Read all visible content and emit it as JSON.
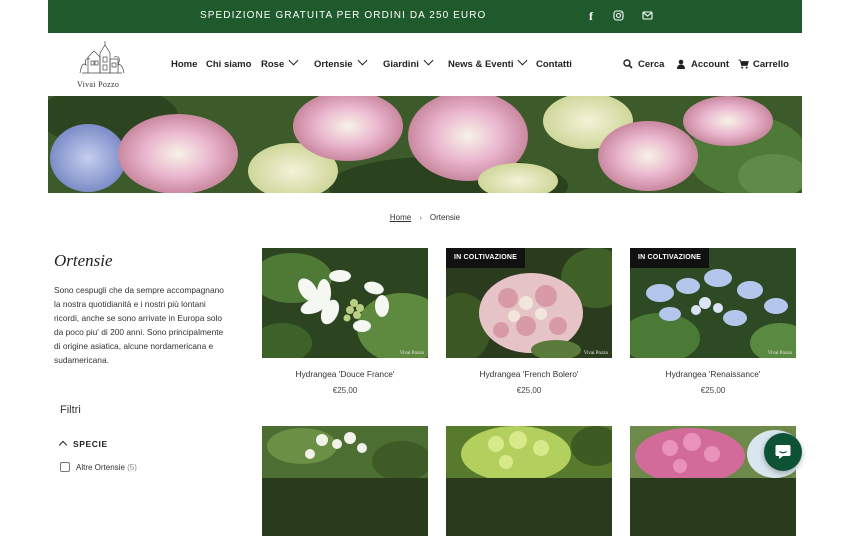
{
  "announcement": {
    "text": "SPEDIZIONE GRATUITA PER ORDINI DA 250 EURO"
  },
  "social": {
    "facebook": "f"
  },
  "logo": {
    "text": "Vivai Pozzo"
  },
  "nav": {
    "items": [
      {
        "label": "Home"
      },
      {
        "label": "Chi siamo"
      },
      {
        "label": "Rose"
      },
      {
        "label": "Ortensie"
      },
      {
        "label": "Giardini"
      },
      {
        "label": "News & Eventi"
      },
      {
        "label": "Contatti"
      }
    ]
  },
  "utility": {
    "search": "Cerca",
    "account": "Account",
    "cart": "Carrello"
  },
  "breadcrumb": {
    "home": "Home",
    "separator": "›",
    "current": "Ortensie"
  },
  "collection": {
    "title": "Ortensie",
    "description": "Sono cespugli che da sempre accompagnano la nostra quotidianità e i nostri più lontani ricordi, anche se sono arrivate in Europa solo da poco piu' di 200 anni. Sono principalmente di origine asiatica, alcune nordamericana e sudamericana."
  },
  "filters": {
    "title": "Filtri",
    "group": "SPECIE",
    "option": {
      "label": "Altre Ortensie",
      "count": "(5)"
    }
  },
  "products": [
    {
      "name": "Hydrangea 'Douce France'",
      "price": "€25,00",
      "badge": "",
      "watermark": "Vivai Pozzo"
    },
    {
      "name": "Hydrangea 'French Bolero'",
      "price": "€25,00",
      "badge": "IN COLTIVAZIONE",
      "watermark": "Vivai Pozzo"
    },
    {
      "name": "Hydrangea 'Renaissance'",
      "price": "€25,00",
      "badge": "IN COLTIVAZIONE",
      "watermark": "Vivai Pozzo"
    }
  ],
  "colors": {
    "announcement_bg": "#1e5a2b",
    "chat_bg": "#0e5236",
    "badge_bg": "#111111"
  }
}
